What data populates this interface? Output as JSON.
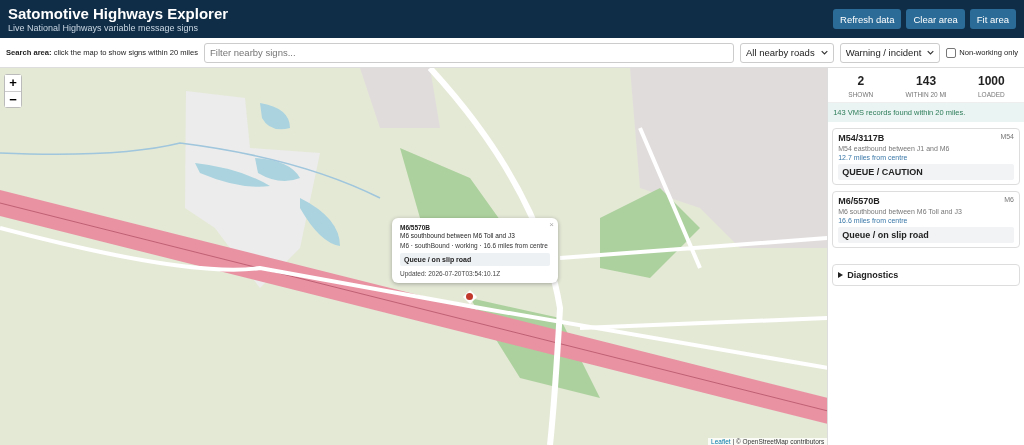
{
  "header": {
    "title": "Satomotive Highways Explorer",
    "subtitle": "Live National Highways variable message signs",
    "buttons": [
      "Refresh data",
      "Clear area",
      "Fit area"
    ]
  },
  "toolbar": {
    "label_bold": "Search area:",
    "label": "click the map to show signs within 20 miles",
    "search": {
      "placeholder": "Filter nearby signs..."
    },
    "road_select": "All nearby roads",
    "type_select": "Warning / incident",
    "non_working_only": {
      "label": "Non-working only",
      "checked": false
    }
  },
  "map": {
    "zoom_in": "+",
    "zoom_out": "−",
    "popup": {
      "title": "M6/5570B",
      "description": "M6 southbound between M6 Toll and J3",
      "meta": "M6 · southBound · working · 16.6 miles from centre",
      "message": "Queue / on slip road",
      "updated": "Updated: 2026-07-20T03:54:10.1Z",
      "close": "×"
    },
    "attribution_link": "Leaflet",
    "attribution": "| © OpenStreetMap contributors"
  },
  "sidebar": {
    "stats": [
      {
        "value": "2",
        "label": "SHOWN"
      },
      {
        "value": "143",
        "label": "WITHIN 20 MI"
      },
      {
        "value": "1000",
        "label": "LOADED"
      }
    ],
    "status": "143 VMS records found within 20 miles.",
    "signs": [
      {
        "id": "M54/3117B",
        "road": "M54",
        "description": "M54 eastbound between J1 and M6",
        "distance": "12.7 miles from centre",
        "message": "QUEUE / CAUTION"
      },
      {
        "id": "M6/5570B",
        "road": "M6",
        "description": "M6 southbound between M6 Toll and J3",
        "distance": "16.6 miles from centre",
        "message": "Queue / on slip road"
      }
    ],
    "diagnostics": {
      "label": "Diagnostics",
      "expanded": false
    }
  }
}
